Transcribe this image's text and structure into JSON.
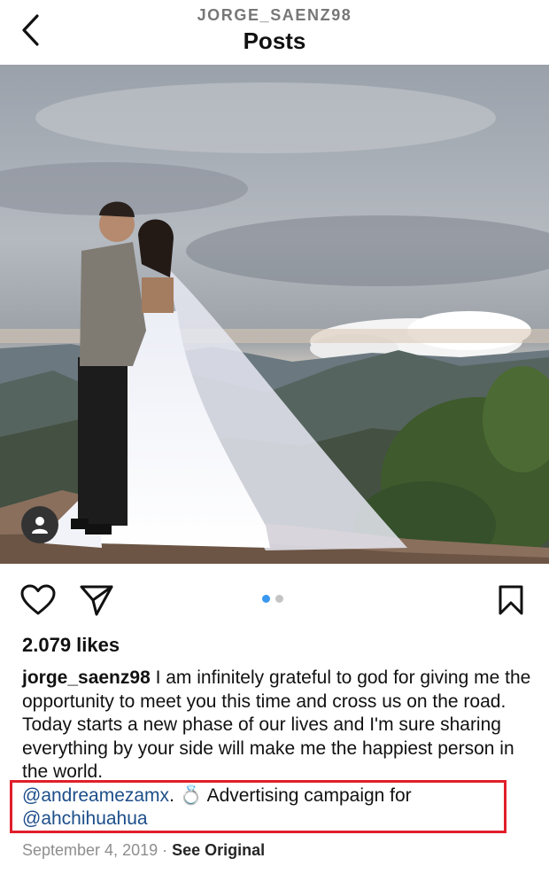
{
  "header": {
    "username": "JORGE_SAENZ98",
    "title": "Posts"
  },
  "post": {
    "likes": "2.079 likes",
    "caption": {
      "username": "jorge_saenz98",
      "text": " I am infinitely grateful to god for giving me the opportunity to meet you this time and cross us on the road. Today starts a new phase of our lives and I'm sure sharing everything by your side will make me the happiest person in the world.",
      "mention1": "@andreamezamx",
      "after_mention1": ". ",
      "ring_emoji": "💍",
      "text2": " Advertising campaign for",
      "mention2": "@ahchihuahua"
    },
    "date": "September 4, 2019",
    "separator": " · ",
    "see_original": "See Original",
    "carousel": {
      "count": 2,
      "active_index": 0
    }
  },
  "icons": {
    "back": "chevron-left-icon",
    "avatar": "user-icon",
    "like": "heart-icon",
    "share": "paper-plane-icon",
    "save": "bookmark-icon"
  },
  "colors": {
    "mention": "#1d4e8a",
    "highlight": "#e01f2b",
    "dot_active": "#3897f0",
    "dot_inactive": "#c4c4c4",
    "meta": "#8e8e8e"
  }
}
